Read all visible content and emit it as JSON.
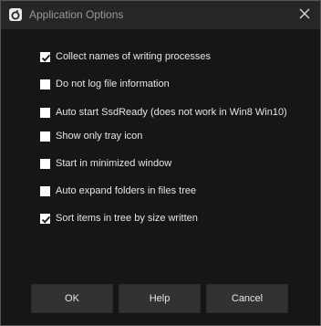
{
  "window": {
    "title": "Application Options",
    "app_icon": "app-logo-icon",
    "close_icon": "close-icon"
  },
  "options": [
    {
      "label": "Collect names of writing processes",
      "checked": true
    },
    {
      "label": "Do not log file information",
      "checked": false
    },
    {
      "label": "Auto start SsdReady (does not work in Win8  Win10)",
      "checked": false
    },
    {
      "label": "Show only tray icon",
      "checked": false
    },
    {
      "label": "Start in minimized window",
      "checked": false
    },
    {
      "label": "Auto expand folders in files tree",
      "checked": false
    },
    {
      "label": "Sort items in tree by size written",
      "checked": true
    }
  ],
  "buttons": {
    "ok": "OK",
    "help": "Help",
    "cancel": "Cancel"
  }
}
